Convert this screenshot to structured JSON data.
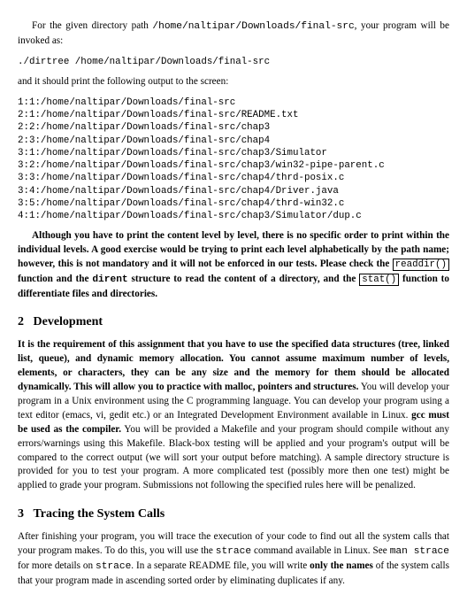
{
  "intro": {
    "line1_pre": "For the given directory path ",
    "path": "/home/naltipar/Downloads/final-src",
    "line1_post": ", your program will be invoked as:",
    "command": "./dirtree /home/naltipar/Downloads/final-src",
    "line2": "and it should print the following output to the screen:"
  },
  "output_lines": [
    "1:1:/home/naltipar/Downloads/final-src",
    "2:1:/home/naltipar/Downloads/final-src/README.txt",
    "2:2:/home/naltipar/Downloads/final-src/chap3",
    "2:3:/home/naltipar/Downloads/final-src/chap4",
    "3:1:/home/naltipar/Downloads/final-src/chap3/Simulator",
    "3:2:/home/naltipar/Downloads/final-src/chap3/win32-pipe-parent.c",
    "3:3:/home/naltipar/Downloads/final-src/chap4/thrd-posix.c",
    "3:4:/home/naltipar/Downloads/final-src/chap4/Driver.java",
    "3:5:/home/naltipar/Downloads/final-src/chap4/thrd-win32.c",
    "4:1:/home/naltipar/Downloads/final-src/chap3/Simulator/dup.c"
  ],
  "para1": {
    "bold1": "Although you have to print the content level by level, there is no specific order to print within the individual levels. A good exercise would be trying to print each level alphabetically by the path name; however, this is not mandatory and it will not be enforced in our tests. Please check the ",
    "box1": "readdir()",
    "bold2": " function and the ",
    "mono1": "dirent",
    "bold3": " structure to read the content of a directory, and the ",
    "box2": "stat()",
    "bold4": " function to differentiate files and directories."
  },
  "section2": {
    "num": "2",
    "title": "Development",
    "bold_lead": "It is the requirement of this assignment that you have to use the specified data structures (tree, linked list, queue), and dynamic memory allocation. You cannot assume maximum number of levels, elements, or characters, they can be any size and the memory for them should be allocated dynamically. This will allow you to practice with malloc, pointers and structures.",
    "rest1": " You will develop your program in a Unix environment using the C programming language. You can develop your program using a text editor (emacs, vi, gedit etc.) or an Integrated Development Environment available in Linux. ",
    "bold_gcc": "gcc must be used as the compiler.",
    "rest2": " You will be provided a Makefile and your program should compile without any errors/warnings using this Makefile. Black-box testing will be applied and your program's output will be compared to the correct output (we will sort your output before matching). A sample directory structure is provided for you to test your program. A more complicated test (possibly more then one test) might be applied to grade your program. Submissions not following the specified rules here will be penalized."
  },
  "section3": {
    "num": "3",
    "title": "Tracing the System Calls",
    "text1": "After finishing your program, you will trace the execution of your code to find out all the system calls that your program makes. To do this, you will use the ",
    "mono1": "strace",
    "text2": " command available in Linux. See ",
    "mono2": "man strace",
    "text3": " for more details on ",
    "mono3": "strace",
    "text4": ". In a separate README file, you will write ",
    "bold1": "only the names",
    "text5": " of the system calls that your program made in ascending sorted order by eliminating duplicates if any."
  }
}
